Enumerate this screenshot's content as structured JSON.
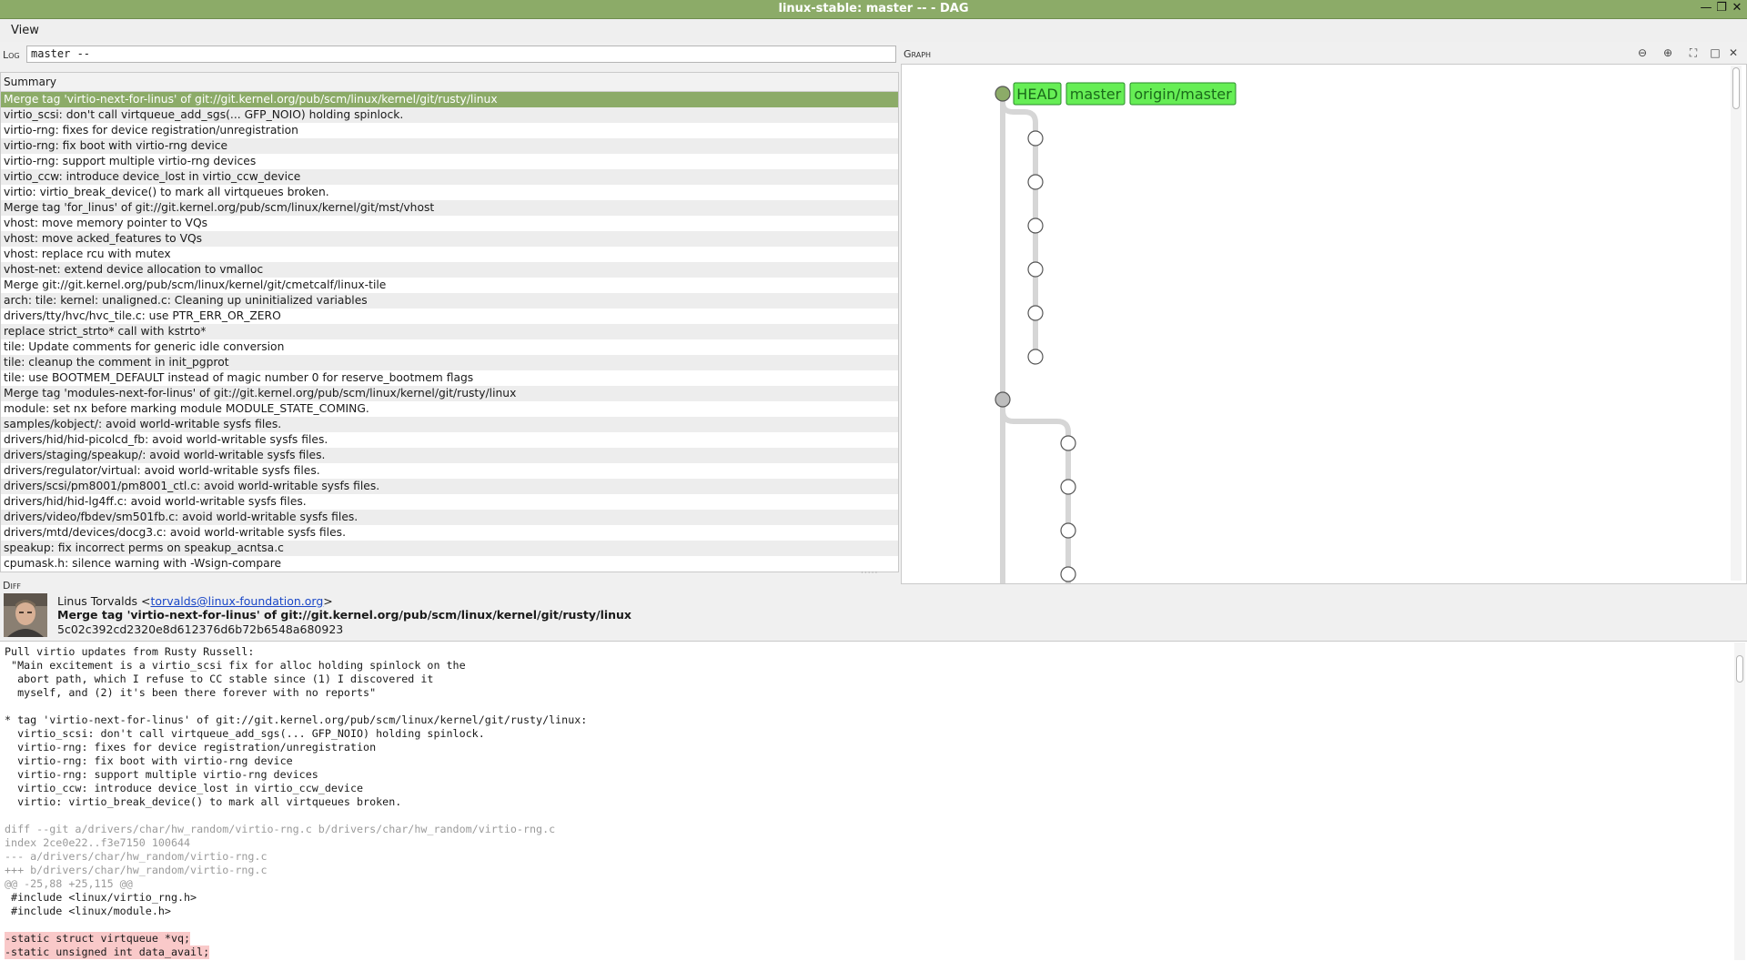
{
  "window": {
    "title": "linux-stable: master -- - DAG"
  },
  "menu": {
    "items": [
      "View"
    ]
  },
  "log": {
    "label": "Log",
    "value": "master --"
  },
  "summary": {
    "header": "Summary",
    "rows": [
      "Merge tag 'virtio-next-for-linus' of git://git.kernel.org/pub/scm/linux/kernel/git/rusty/linux",
      "virtio_scsi: don't call virtqueue_add_sgs(... GFP_NOIO) holding spinlock.",
      "virtio-rng: fixes for device registration/unregistration",
      "virtio-rng: fix boot with virtio-rng device",
      "virtio-rng: support multiple virtio-rng devices",
      "virtio_ccw: introduce device_lost in virtio_ccw_device",
      "virtio: virtio_break_device() to mark all virtqueues broken.",
      "Merge tag 'for_linus' of git://git.kernel.org/pub/scm/linux/kernel/git/mst/vhost",
      "vhost: move memory pointer to VQs",
      "vhost: move acked_features to VQs",
      "vhost: replace rcu with mutex",
      "vhost-net: extend device allocation to vmalloc",
      "Merge git://git.kernel.org/pub/scm/linux/kernel/git/cmetcalf/linux-tile",
      "arch: tile: kernel: unaligned.c: Cleaning up uninitialized variables",
      "drivers/tty/hvc/hvc_tile.c: use PTR_ERR_OR_ZERO",
      "replace strict_strto* call with kstrto*",
      "tile: Update comments for generic idle conversion",
      "tile: cleanup the comment in init_pgprot",
      "tile: use BOOTMEM_DEFAULT instead of magic number 0 for reserve_bootmem flags",
      "Merge tag 'modules-next-for-linus' of git://git.kernel.org/pub/scm/linux/kernel/git/rusty/linux",
      "module: set nx before marking module MODULE_STATE_COMING.",
      "samples/kobject/: avoid world-writable sysfs files.",
      "drivers/hid/hid-picolcd_fb: avoid world-writable sysfs files.",
      "drivers/staging/speakup/: avoid world-writable sysfs files.",
      "drivers/regulator/virtual: avoid world-writable sysfs files.",
      "drivers/scsi/pm8001/pm8001_ctl.c: avoid world-writable sysfs files.",
      "drivers/hid/hid-lg4ff.c: avoid world-writable sysfs files.",
      "drivers/video/fbdev/sm501fb.c: avoid world-writable sysfs files.",
      "drivers/mtd/devices/docg3.c: avoid world-writable sysfs files.",
      "speakup: fix incorrect perms on speakup_acntsa.c",
      "cpumask.h: silence warning with -Wsign-compare"
    ]
  },
  "graph": {
    "label": "Graph",
    "refs": [
      "HEAD",
      "master",
      "origin/master"
    ],
    "colors": {
      "ref_bg": "#66ee55",
      "ref_border": "#2a8a2a",
      "lane": "#d6d6d6",
      "selected": "#8cab68"
    }
  },
  "diff": {
    "label": "Diff",
    "author_name": "Linus Torvalds <",
    "author_email": "torvalds@linux-foundation.org",
    "author_close": ">",
    "subject": "Merge tag 'virtio-next-for-linus' of git://git.kernel.org/pub/scm/linux/kernel/git/rusty/linux",
    "sha": "5c02c392cd2320e8d612376d6b72b6548a680923",
    "lines": [
      {
        "t": "Pull virtio updates from Rusty Russell:",
        "k": "n"
      },
      {
        "t": " \"Main excitement is a virtio_scsi fix for alloc holding spinlock on the",
        "k": "n"
      },
      {
        "t": "  abort path, which I refuse to CC stable since (1) I discovered it",
        "k": "n"
      },
      {
        "t": "  myself, and (2) it's been there forever with no reports\"",
        "k": "n"
      },
      {
        "t": "",
        "k": "n"
      },
      {
        "t": "* tag 'virtio-next-for-linus' of git://git.kernel.org/pub/scm/linux/kernel/git/rusty/linux:",
        "k": "n"
      },
      {
        "t": "  virtio_scsi: don't call virtqueue_add_sgs(... GFP_NOIO) holding spinlock.",
        "k": "n"
      },
      {
        "t": "  virtio-rng: fixes for device registration/unregistration",
        "k": "n"
      },
      {
        "t": "  virtio-rng: fix boot with virtio-rng device",
        "k": "n"
      },
      {
        "t": "  virtio-rng: support multiple virtio-rng devices",
        "k": "n"
      },
      {
        "t": "  virtio_ccw: introduce device_lost in virtio_ccw_device",
        "k": "n"
      },
      {
        "t": "  virtio: virtio_break_device() to mark all virtqueues broken.",
        "k": "n"
      },
      {
        "t": "",
        "k": "n"
      },
      {
        "t": "diff --git a/drivers/char/hw_random/virtio-rng.c b/drivers/char/hw_random/virtio-rng.c",
        "k": "m"
      },
      {
        "t": "index 2ce0e22..f3e7150 100644",
        "k": "m"
      },
      {
        "t": "--- a/drivers/char/hw_random/virtio-rng.c",
        "k": "m"
      },
      {
        "t": "+++ b/drivers/char/hw_random/virtio-rng.c",
        "k": "m"
      },
      {
        "t": "@@ -25,88 +25,115 @@",
        "k": "m"
      },
      {
        "t": " #include <linux/virtio_rng.h>",
        "k": "n"
      },
      {
        "t": " #include <linux/module.h>",
        "k": "n"
      },
      {
        "t": "",
        "k": "n"
      },
      {
        "t": "-static struct virtqueue *vq;",
        "k": "d"
      },
      {
        "t": "-static unsigned int data_avail;",
        "k": "d"
      }
    ]
  }
}
